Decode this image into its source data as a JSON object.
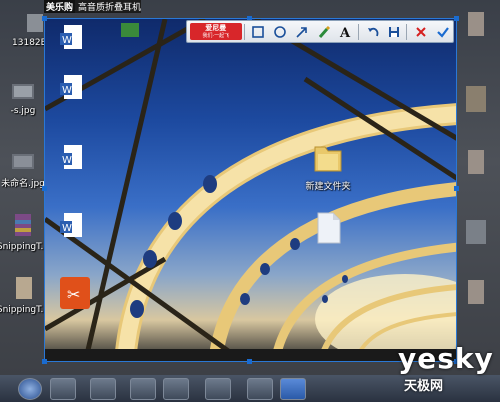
{
  "topbar": {
    "brand": "美乐购",
    "title": "高音质折叠耳机"
  },
  "left_icons": [
    {
      "label": "13182EUL",
      "icon": "file-icon"
    },
    {
      "label": "-s.jpg",
      "icon": "image-file-icon"
    },
    {
      "label": "未命名.jpg",
      "icon": "image-file-icon"
    },
    {
      "label": "SnippingT...",
      "icon": "archive-icon"
    },
    {
      "label": "SnippingT...",
      "icon": "file-icon"
    }
  ],
  "selection_icons": [
    {
      "label": "新建文件夹",
      "icon": "folder-icon"
    }
  ],
  "toolbar": {
    "logo_main": "爱尼曼",
    "logo_sub": "我们·一起飞",
    "buttons": [
      "rectangle-tool-icon",
      "ellipse-tool-icon",
      "arrow-tool-icon",
      "brush-tool-icon",
      "text-tool-icon",
      "undo-icon",
      "save-icon",
      "cancel-icon",
      "confirm-icon"
    ]
  },
  "watermark": {
    "big": "yesky",
    "cn": "天极网"
  },
  "colors": {
    "selection_border": "#2a78d6",
    "cancel": "#d62020",
    "confirm": "#1a6bd0"
  }
}
